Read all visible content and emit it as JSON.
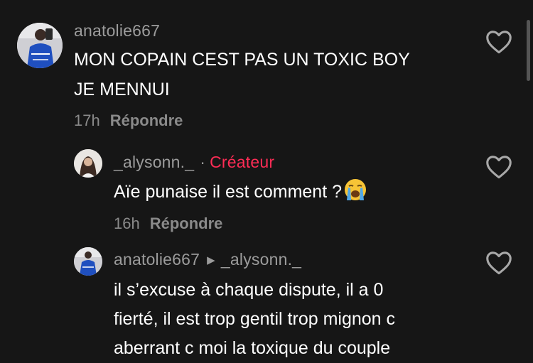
{
  "comments": [
    {
      "username": "anatolie667",
      "text_lines": [
        "MON COPAIN CEST PAS UN TOXIC BOY",
        "JE MENNUI"
      ],
      "time": "17h",
      "reply_label": "Répondre"
    },
    {
      "username": "_alysonn._",
      "separator": "·",
      "badge": "Créateur",
      "text": "Aïe punaise il est comment ?",
      "emoji": "loudly-crying-face-emoji",
      "time": "16h",
      "reply_label": "Répondre"
    },
    {
      "username": "anatolie667",
      "reply_to": "_alysonn._",
      "text_lines": [
        "il s’excuse à chaque dispute, il a 0",
        "fierté, il est trop gentil trop mignon c",
        "aberrant c moi la toxique du couple"
      ]
    }
  ],
  "icons": {
    "like": "heart-outline-icon",
    "reply_arrow": "triangle-right-icon"
  },
  "colors": {
    "background": "#161616",
    "creator_badge": "#fe2c55",
    "username": "#9c9c9c",
    "meta": "#8a8a8a"
  }
}
